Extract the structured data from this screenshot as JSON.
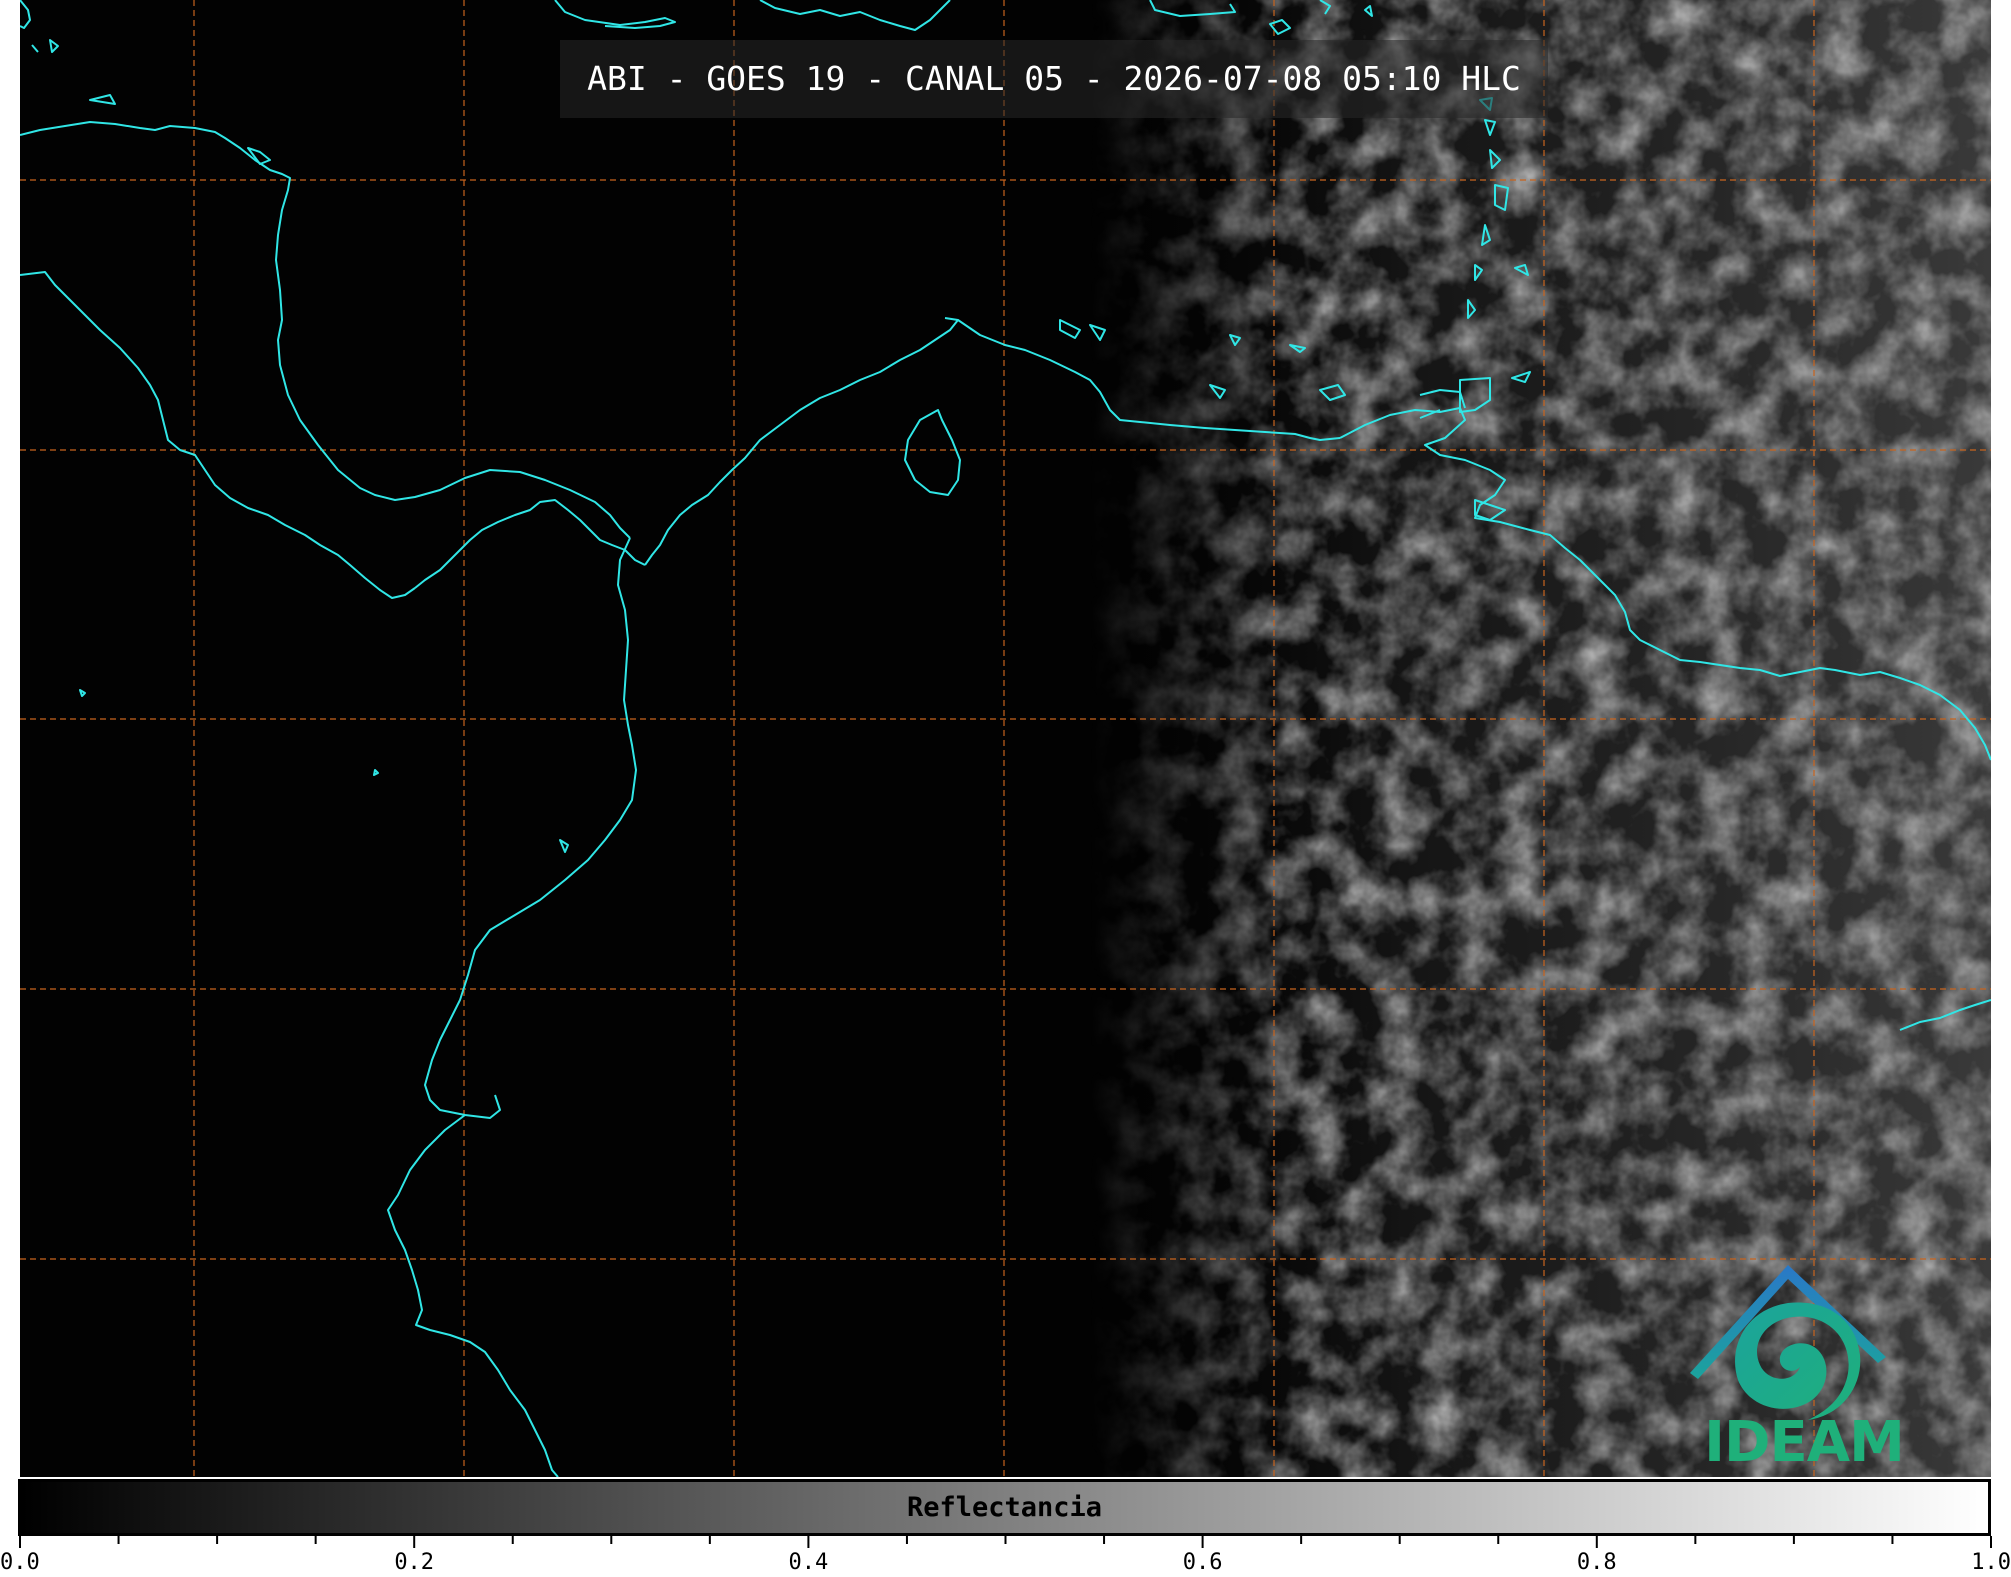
{
  "title": "ABI - GOES 19 - CANAL 05 - 2026-07-08 05:10 HLC",
  "colorbar": {
    "label": "Reflectancia",
    "min": 0.0,
    "max": 1.0,
    "tick_labels": [
      "0.0",
      "0.2",
      "0.4",
      "0.6",
      "0.8",
      "1.0"
    ],
    "colormap": "gray",
    "colors": [
      "#000000",
      "#ffffff"
    ]
  },
  "map": {
    "background_color": "#020202",
    "coastline_color": "#30e6e6",
    "grid_color": "#c8641e",
    "grid_style": "dashed"
  },
  "logo": {
    "text": "IDEAM",
    "text_color": "#1fb07a",
    "roof_color": "#2a78c8",
    "swirl_color": "#1ba39c"
  }
}
